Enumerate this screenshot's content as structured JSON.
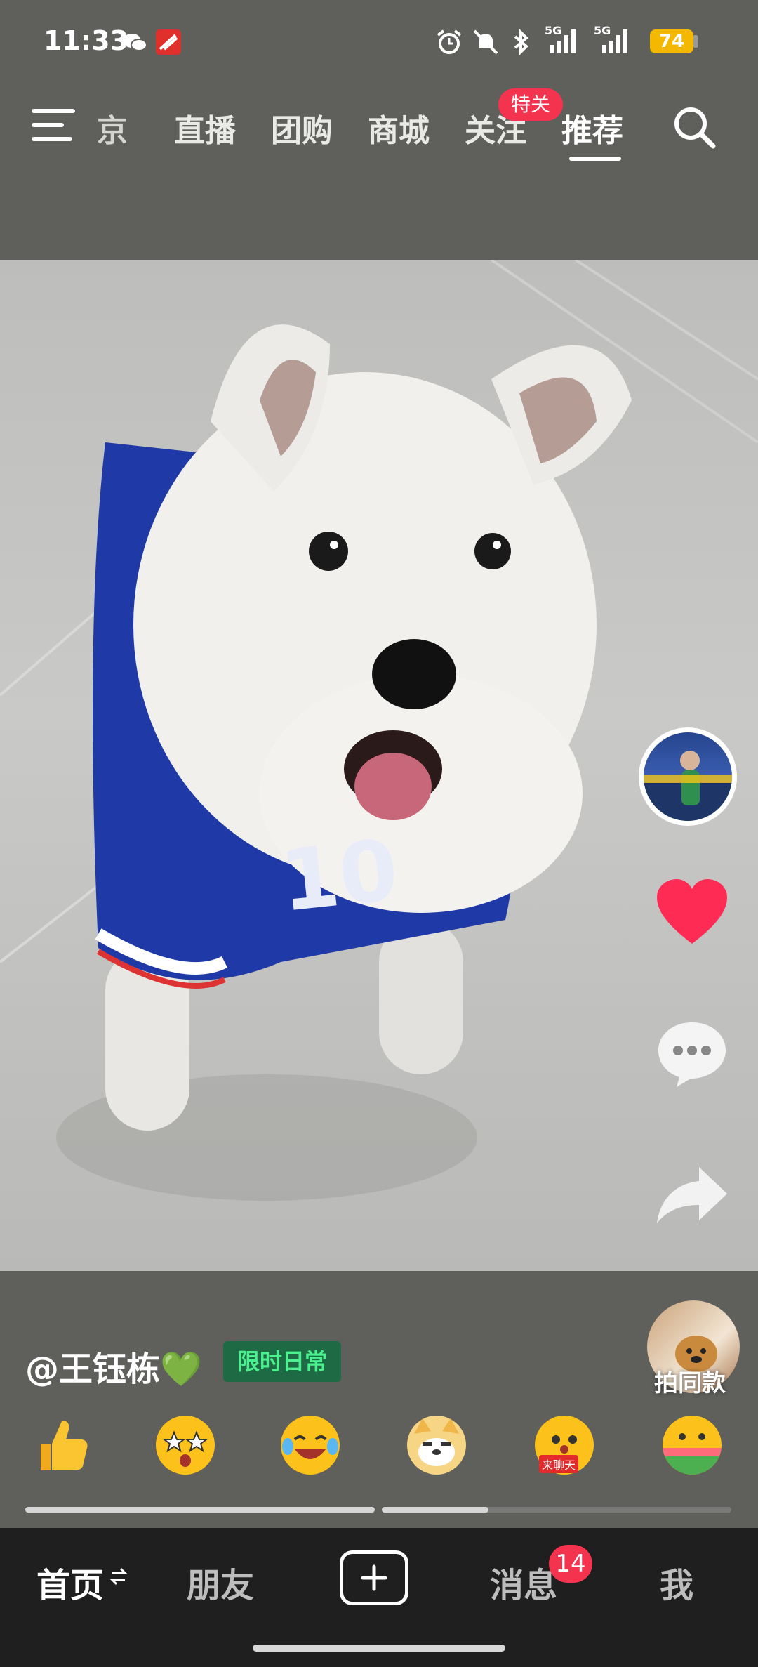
{
  "status_bar": {
    "time": "11:33",
    "battery": "74",
    "signal_1": "5G",
    "signal_2": "5G"
  },
  "top_nav": {
    "tabs": [
      {
        "label": "京"
      },
      {
        "label": "直播"
      },
      {
        "label": "团购"
      },
      {
        "label": "商城"
      },
      {
        "label": "关注"
      },
      {
        "label": "推荐"
      }
    ],
    "active_tab": "推荐",
    "special_badge": "特关"
  },
  "post": {
    "author": "@王钰栋💚",
    "tag": "限时日常",
    "same_style_label": "拍同款",
    "jersey_number": "10"
  },
  "emoji_bar": [
    {
      "name": "thumbs-up"
    },
    {
      "name": "starry-eyes"
    },
    {
      "name": "laughing-tears"
    },
    {
      "name": "doge"
    },
    {
      "name": "chat-hug",
      "label": "来聊天"
    },
    {
      "name": "watermelon-face"
    }
  ],
  "progress": {
    "segments": 2,
    "current_segment_progress": 0.3
  },
  "bottom_nav": {
    "home": "首页",
    "friends": "朋友",
    "messages": "消息",
    "messages_badge": "14",
    "me": "我"
  },
  "colors": {
    "accent_red": "#f4334f",
    "tag_green": "#4cf08e",
    "battery_yellow": "#f5b800"
  }
}
